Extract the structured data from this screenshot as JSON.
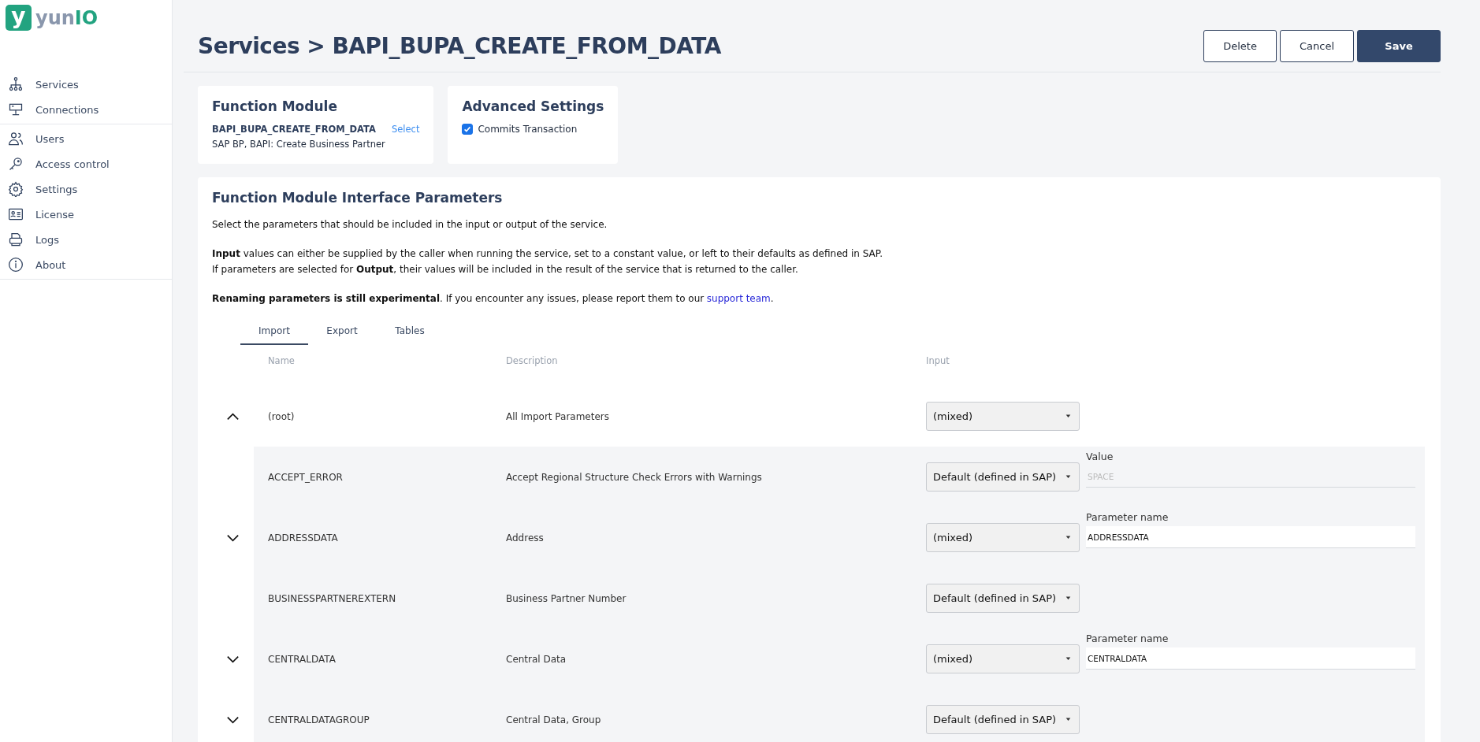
{
  "logo": {
    "mark": "y",
    "name_a": "yun",
    "name_b": "IO"
  },
  "sidebar": {
    "groups": [
      [
        {
          "label": "Services",
          "selected": false
        },
        {
          "label": "Connections",
          "selected": false
        }
      ],
      [
        {
          "label": "Users",
          "selected": false
        },
        {
          "label": "Access control",
          "selected": false
        },
        {
          "label": "Settings",
          "selected": false
        },
        {
          "label": "License",
          "selected": false
        },
        {
          "label": "Logs",
          "selected": false
        },
        {
          "label": "About",
          "selected": false
        }
      ]
    ]
  },
  "header": {
    "title": "Services > BAPI_BUPA_CREATE_FROM_DATA",
    "buttons": [
      {
        "label": "Delete",
        "kind": "secondary"
      },
      {
        "label": "Cancel",
        "kind": "secondary"
      },
      {
        "label": "Save",
        "kind": "primary"
      }
    ]
  },
  "function_module": {
    "title": "Function Module",
    "name": "BAPI_BUPA_CREATE_FROM_DATA",
    "link": "Select",
    "description": "SAP BP, BAPI: Create Business Partner"
  },
  "advanced_settings": {
    "title": "Advanced Settings",
    "options": [
      {
        "label": "Commits Transaction",
        "checked": true
      }
    ]
  },
  "parameters": {
    "title": "Function Module Interface Parameters",
    "paragraphs": [
      [
        "Select the parameters that should be included in the input or output of the service."
      ],
      [
        "**Input** values can either be supplied by the caller when running the service, set to a constant value, or left to their defaults as defined in SAP.",
        "If parameters are selected for **Output**, their values will be included in the result of the service that is returned to the caller."
      ]
    ],
    "notice": {
      "text": "**Renaming parameters is still experimental**. If you encounter any issues, please report them to our",
      "link": "support team",
      "end": "."
    },
    "tabs": [
      {
        "label": "Import",
        "selected": true
      },
      {
        "label": "Export",
        "selected": false
      },
      {
        "label": "Tables",
        "selected": false
      }
    ],
    "columns": [
      "Name",
      "Description",
      "Input"
    ],
    "rows": [
      {
        "kind": "root",
        "name": "(root)",
        "description": "All Import Parameters",
        "input": "(mixed)",
        "expanded": true
      },
      {
        "kind": "child",
        "name": "ACCEPT_ERROR",
        "description": "Accept Regional Structure Check Errors with Warnings",
        "input": "Default (defined in SAP)",
        "field": {
          "label": "Value",
          "value": "SPACE",
          "disabled": true
        }
      },
      {
        "kind": "child",
        "name": "ADDRESSDATA",
        "description": "Address",
        "input": "(mixed)",
        "expanded": false,
        "field": {
          "label": "Parameter name",
          "value": "ADDRESSDATA",
          "disabled": false
        }
      },
      {
        "kind": "child",
        "name": "BUSINESSPARTNEREXTERN",
        "description": "Business Partner Number",
        "input": "Default (defined in SAP)"
      },
      {
        "kind": "child",
        "name": "CENTRALDATA",
        "description": "Central Data",
        "input": "(mixed)",
        "expanded": false,
        "field": {
          "label": "Parameter name",
          "value": "CENTRALDATA",
          "disabled": false
        }
      },
      {
        "kind": "child",
        "name": "CENTRALDATAGROUP",
        "description": "Central Data, Group",
        "input": "Default (defined in SAP)",
        "expanded": false
      }
    ]
  }
}
